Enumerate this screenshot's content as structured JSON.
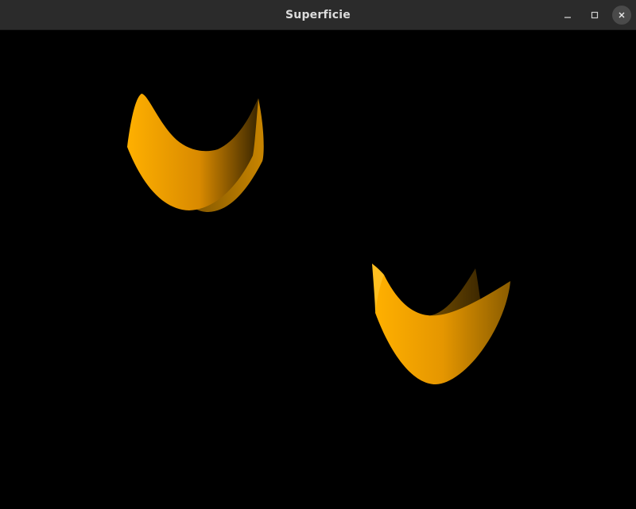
{
  "window": {
    "title": "Superficie",
    "controls": {
      "minimize_icon": "minimize-icon",
      "maximize_icon": "maximize-icon",
      "close_icon": "close-icon"
    }
  },
  "scene": {
    "background_color": "#000000",
    "surface_color": "#ffaa00",
    "surface_shadow_color": "#3a2600",
    "objects": [
      "saddle-surface-1",
      "saddle-surface-2"
    ]
  }
}
